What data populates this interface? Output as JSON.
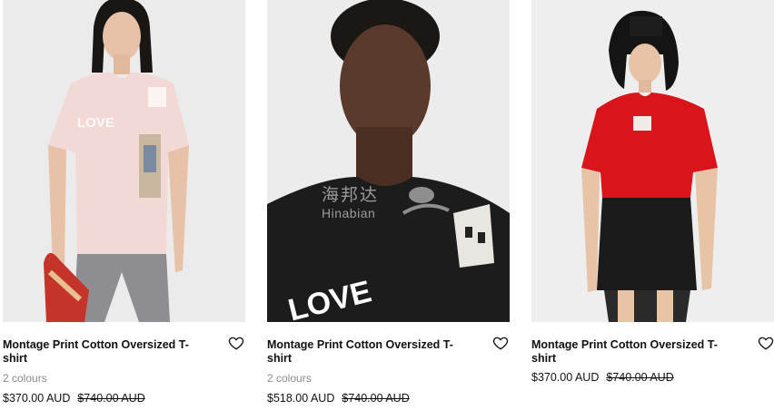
{
  "products": [
    {
      "title": "Montage Print Cotton Oversized T-shirt",
      "colours": "2 colours",
      "price": "$370.00 AUD",
      "original_price": "$740.00 AUD",
      "shirt_text": "LOVE",
      "wishlist_icon": "heart-outline-icon"
    },
    {
      "title": "Montage Print Cotton Oversized T-shirt",
      "colours": "2 colours",
      "price": "$518.00 AUD",
      "original_price": "$740.00 AUD",
      "shirt_text": "LOVE",
      "watermark_cn": "海邦达",
      "watermark_en": "Hinabian",
      "wishlist_icon": "heart-outline-icon"
    },
    {
      "title": "Montage Print Cotton Oversized T-shirt",
      "price": "$370.00 AUD",
      "original_price": "$740.00 AUD",
      "wishlist_icon": "heart-outline-icon"
    }
  ],
  "colors": {
    "pink_tee": "#f3d9d6",
    "black_tee": "#1c1c1c",
    "red_tee": "#d9141b",
    "muted_text": "#8a8a8a"
  }
}
